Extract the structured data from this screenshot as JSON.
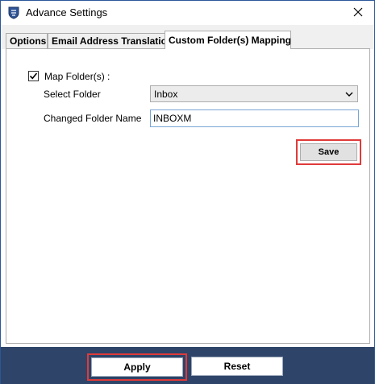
{
  "window": {
    "title": "Advance Settings",
    "icon": "app-shield-icon",
    "close_icon": "close-icon"
  },
  "tabs": [
    {
      "label": "Options",
      "active": false
    },
    {
      "label": "Email Address Translation",
      "active": false
    },
    {
      "label": "Custom Folder(s) Mapping",
      "active": true
    }
  ],
  "mapping": {
    "map_folders_label": "Map Folder(s) :",
    "map_folders_checked": true,
    "select_folder_label": "Select Folder",
    "select_folder_value": "Inbox",
    "changed_name_label": "Changed Folder Name",
    "changed_name_value": "INBOXM",
    "save_label": "Save"
  },
  "footer": {
    "apply_label": "Apply",
    "reset_label": "Reset"
  },
  "colors": {
    "footer_bg": "#2e4468",
    "highlight": "#e03a3a",
    "window_border": "#2b579a"
  }
}
